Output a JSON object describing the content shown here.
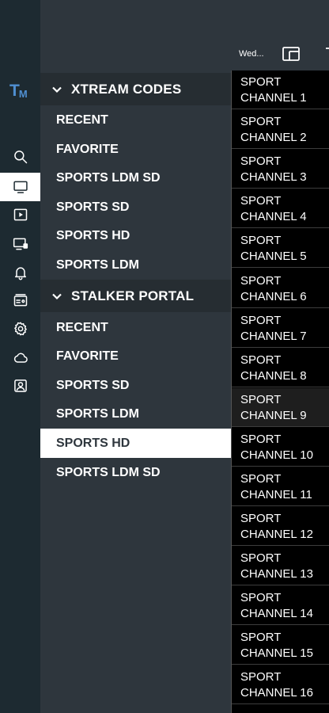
{
  "topbar": {
    "date_label": "Wed..."
  },
  "logo": {
    "big": "T",
    "small": "M"
  },
  "sections": [
    {
      "title": "XTREAM CODES",
      "items": [
        "RECENT",
        "FAVORITE",
        "SPORTS LDM SD",
        "SPORTS SD",
        "SPORTS HD",
        "SPORTS LDM"
      ]
    },
    {
      "title": "STALKER PORTAL",
      "items": [
        "RECENT",
        "FAVORITE",
        "SPORTS SD",
        "SPORTS LDM",
        "SPORTS HD",
        "SPORTS LDM SD"
      ],
      "selected": "SPORTS HD"
    }
  ],
  "channels": [
    [
      "SPORT",
      "CHANNEL 1"
    ],
    [
      "SPORT",
      "CHANNEL 2"
    ],
    [
      "SPORT",
      "CHANNEL 3"
    ],
    [
      "SPORT",
      "CHANNEL 4"
    ],
    [
      "SPORT",
      "CHANNEL 5"
    ],
    [
      "SPORT",
      "CHANNEL 6"
    ],
    [
      "SPORT",
      "CHANNEL 7"
    ],
    [
      "SPORT",
      "CHANNEL 8"
    ],
    [
      "SPORT",
      "CHANNEL 9"
    ],
    [
      "SPORT",
      "CHANNEL 10"
    ],
    [
      "SPORT",
      "CHANNEL 11"
    ],
    [
      "SPORT",
      "CHANNEL 12"
    ],
    [
      "SPORT",
      "CHANNEL 13"
    ],
    [
      "SPORT",
      "CHANNEL 14"
    ],
    [
      "SPORT",
      "CHANNEL 15"
    ],
    [
      "SPORT",
      "CHANNEL 16"
    ]
  ],
  "rail_icons": [
    "search-icon",
    "tv-icon",
    "play-icon",
    "devices-icon",
    "bell-icon",
    "epg-icon",
    "gear-icon",
    "cloud-icon",
    "account-icon"
  ],
  "colors": {
    "rail_bg": "#1d2a31",
    "panel_bg": "#2e363d",
    "header_bg": "#262d32",
    "logo": "#4f8fd1",
    "channel_bg": "#000000"
  }
}
